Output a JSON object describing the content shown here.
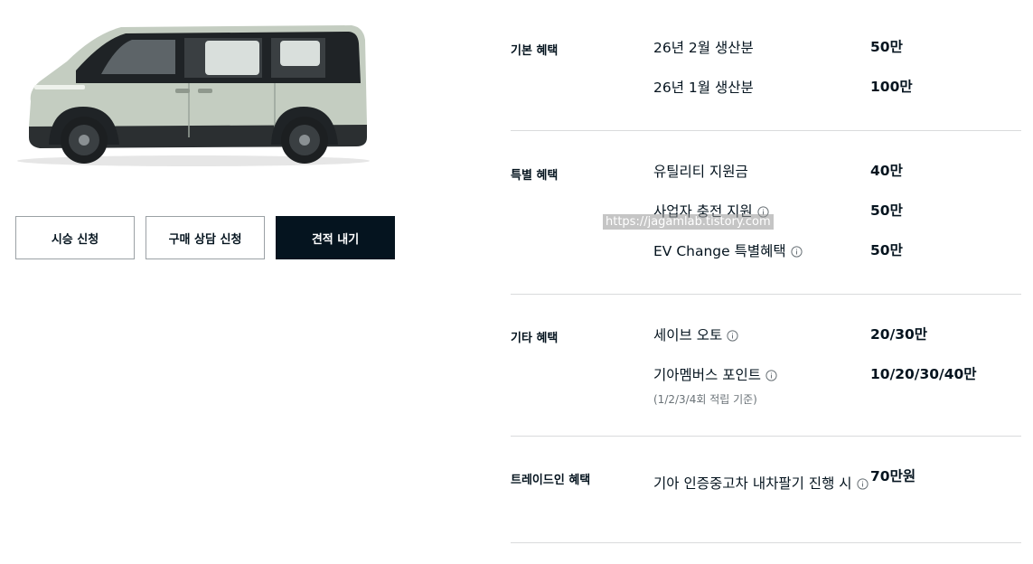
{
  "buttons": {
    "test_drive": "시승 신청",
    "consult": "구매 상담 신청",
    "quote": "견적 내기"
  },
  "benefits": [
    {
      "title": "기본 혜택",
      "items": [
        {
          "name": "26년 2월 생산분",
          "value": "50만"
        },
        {
          "name": "26년 1월 생산분",
          "value": "100만"
        }
      ]
    },
    {
      "title": "특별 혜택",
      "items": [
        {
          "name": "유틸리티 지원금",
          "value": "40만"
        },
        {
          "name": "사업자 충전 지원",
          "value": "50만",
          "info": true
        },
        {
          "name": "EV Change 특별혜택",
          "value": "50만",
          "info": true
        }
      ]
    },
    {
      "title": "기타 혜택",
      "items": [
        {
          "name": "세이브 오토",
          "value": "20/30만",
          "info": true
        },
        {
          "name": "기아멤버스 포인트",
          "value": "10/20/30/40만",
          "info": true,
          "sub": "(1/2/3/4회 적립 기준)"
        }
      ]
    },
    {
      "title": "트레이드인 혜택",
      "items": [
        {
          "name": "기아 인증중고차",
          "name2": "내차팔기 진행 시",
          "value": "70만원",
          "info": true
        }
      ]
    }
  ],
  "watermark": "https://jagamlab.tistory.com",
  "colors": {
    "primary": "#05141f",
    "divider": "#d9dbdc",
    "car_body": "#c4cdc1"
  }
}
